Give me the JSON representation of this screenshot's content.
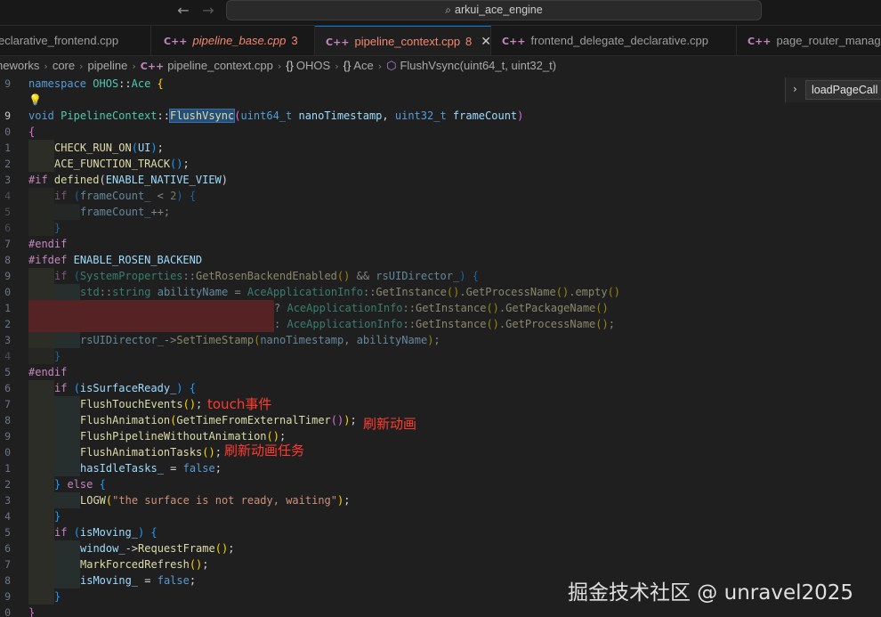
{
  "titlebar": {
    "back_icon": "arrow-left-icon",
    "forward_icon": "arrow-right-icon",
    "search_text": "arkui_ace_engine"
  },
  "tabs": [
    {
      "label": "eclarative_frontend.cpp",
      "count": "",
      "modified": false,
      "active": false
    },
    {
      "label": "pipeline_base.cpp",
      "count": "3",
      "modified": true,
      "active": false
    },
    {
      "label": "pipeline_context.cpp",
      "count": "8",
      "modified": true,
      "active": true
    },
    {
      "label": "frontend_delegate_declarative.cpp",
      "count": "",
      "modified": false,
      "active": false
    },
    {
      "label": "page_router_manager",
      "count": "",
      "modified": false,
      "active": false
    }
  ],
  "breadcrumb": {
    "items": [
      "neworks",
      "core",
      "pipeline",
      "pipeline_context.cpp",
      "OHOS",
      "Ace",
      "FlushVsync(uint64_t, uint32_t)"
    ]
  },
  "outline": {
    "label": "loadPageCall"
  },
  "line_numbers": [
    "9",
    "",
    "9",
    "0",
    "1",
    "2",
    "3",
    "4",
    "5",
    "6",
    "7",
    "8",
    "9",
    "0",
    "1",
    "2",
    "3",
    "4",
    "5",
    "6",
    "7",
    "8",
    "9",
    "0",
    "1",
    "2",
    "3",
    "4",
    "5",
    "6",
    "7",
    "8",
    "9",
    "0"
  ],
  "annotations": {
    "touch": "touch事件",
    "animation": "刷新动画",
    "animation_tasks": "刷新动画任务"
  },
  "watermark": "掘金技术社区 @ unravel2025",
  "colors": {
    "background": "#1f1f1f",
    "accent": "#0078d4",
    "annotation": "#ff3b30",
    "error_tab": "#f48771"
  }
}
